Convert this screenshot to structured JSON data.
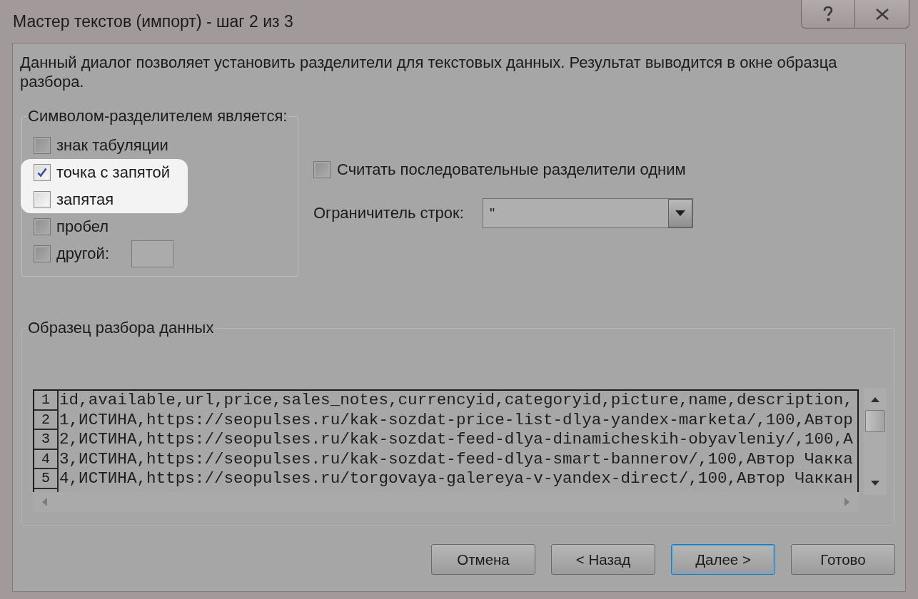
{
  "window": {
    "title": "Мастер текстов (импорт) - шаг 2 из 3"
  },
  "description": "Данный диалог позволяет установить разделители для текстовых данных. Результат выводится в окне образца разбора.",
  "delimiters": {
    "legend": "Символом-разделителем является:",
    "items": [
      {
        "kind": "checkbox",
        "label": "знак табуляции",
        "checked": false,
        "highlighted": false
      },
      {
        "kind": "checkbox",
        "label": "точка с запятой",
        "checked": true,
        "highlighted": true
      },
      {
        "kind": "checkbox",
        "label": "запятая",
        "checked": false,
        "highlighted": true
      },
      {
        "kind": "checkbox",
        "label": "пробел",
        "checked": false,
        "highlighted": false
      },
      {
        "kind": "checkbox_with_field",
        "label": "другой:",
        "checked": false,
        "highlighted": false
      }
    ]
  },
  "consecutive_delimiters": {
    "label": "Считать последовательные разделители одним",
    "checked": false
  },
  "text_qualifier": {
    "label": "Ограничитель строк:",
    "value": "\""
  },
  "preview": {
    "legend": "Образец разбора данных",
    "rows": [
      {
        "number": "1",
        "text": "id,available,url,price,sales_notes,currencyid,categoryid,picture,name,description,"
      },
      {
        "number": "2",
        "text": "1,ИСТИНА,https://seopulses.ru/kak-sozdat-price-list-dlya-yandex-marketa/,100,Автор"
      },
      {
        "number": "3",
        "text": "2,ИСТИНА,https://seopulses.ru/kak-sozdat-feed-dlya-dinamicheskih-obyavleniy/,100,А"
      },
      {
        "number": "4",
        "text": "3,ИСТИНА,https://seopulses.ru/kak-sozdat-feed-dlya-smart-bannerov/,100,Автор Чакка"
      },
      {
        "number": "5",
        "text": "4,ИСТИНА,https://seopulses.ru/torgovaya-galereya-v-yandex-direct/,100,Автор Чаккан"
      }
    ]
  },
  "buttons": [
    {
      "label": "Отмена",
      "focused": false
    },
    {
      "label": "< Назад",
      "focused": false
    },
    {
      "label": "Далее >",
      "focused": true
    },
    {
      "label": "Готово",
      "focused": false
    }
  ]
}
